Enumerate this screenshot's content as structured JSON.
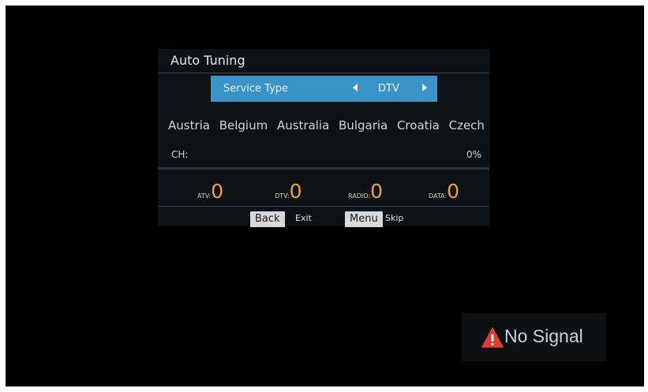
{
  "dialog": {
    "title": "Auto Tuning",
    "service": {
      "label": "Service Type",
      "value": "DTV"
    },
    "countries": [
      "Austria",
      "Belgium",
      "Australia",
      "Bulgaria",
      "Croatia",
      "Czech"
    ],
    "channel": {
      "label": "CH:",
      "progress_text": "0%",
      "progress": 0
    },
    "counters": [
      {
        "label": "ATV:",
        "value": "0"
      },
      {
        "label": "DTV:",
        "value": "0"
      },
      {
        "label": "RADIO:",
        "value": "0"
      },
      {
        "label": "DATA:",
        "value": "0"
      }
    ],
    "keys": [
      {
        "key": "Back",
        "action": "Exit"
      },
      {
        "key": "Menu",
        "action": "Skip"
      }
    ]
  },
  "status": {
    "no_signal": "No Signal",
    "icon": "warning-icon",
    "icon_color": "#e53935"
  },
  "colors": {
    "accent": "#3a94c8",
    "counter": "#f0a030"
  }
}
